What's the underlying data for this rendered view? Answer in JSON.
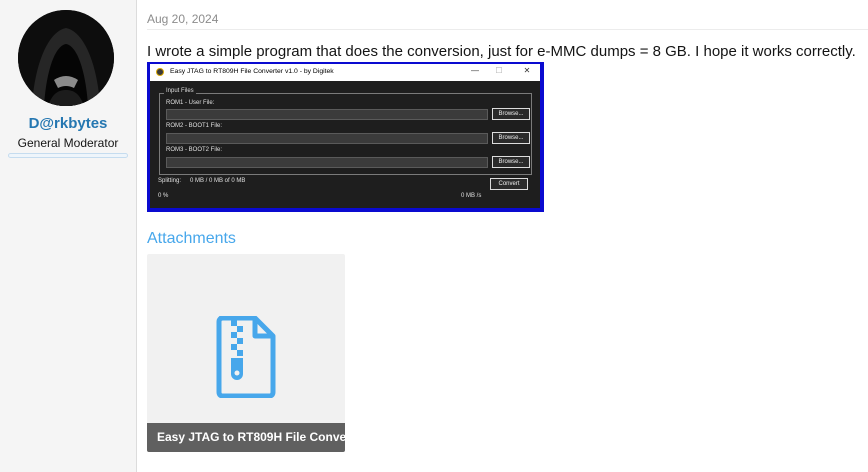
{
  "user": {
    "name": "D@rkbytes",
    "title": "General Moderator"
  },
  "post": {
    "date": "Aug 20, 2024",
    "message": "I wrote a simple program that does the conversion, just for e-MMC dumps = 8 GB. I hope it works correctly."
  },
  "app_window": {
    "title": "Easy JTAG to RT809H File Converter v1.0 - by Digitek",
    "controls": {
      "minimize": "—",
      "maximize": "☐",
      "close": "✕"
    },
    "group_label": "Input Files",
    "fields": [
      {
        "label": "ROM1 - User File:",
        "button": "Browse..."
      },
      {
        "label": "ROM2 - BOOT1 File:",
        "button": "Browse..."
      },
      {
        "label": "ROM3 - BOOT2 File:",
        "button": "Browse..."
      }
    ],
    "splitting_label": "Splitting:",
    "splitting_value": "0 MB / 0 MB of 0 MB",
    "convert_button": "Convert",
    "percent": "0 %",
    "speed": "0 MB /s"
  },
  "attachments": {
    "heading": "Attachments",
    "items": [
      {
        "name": "Easy JTAG to RT809H File Conve...",
        "icon": "zip-file-icon",
        "icon_color": "#47a7eb"
      }
    ]
  },
  "colors": {
    "accent": "#2577b1",
    "link": "#47a7eb",
    "screenshot_border": "#0a0ad0"
  }
}
